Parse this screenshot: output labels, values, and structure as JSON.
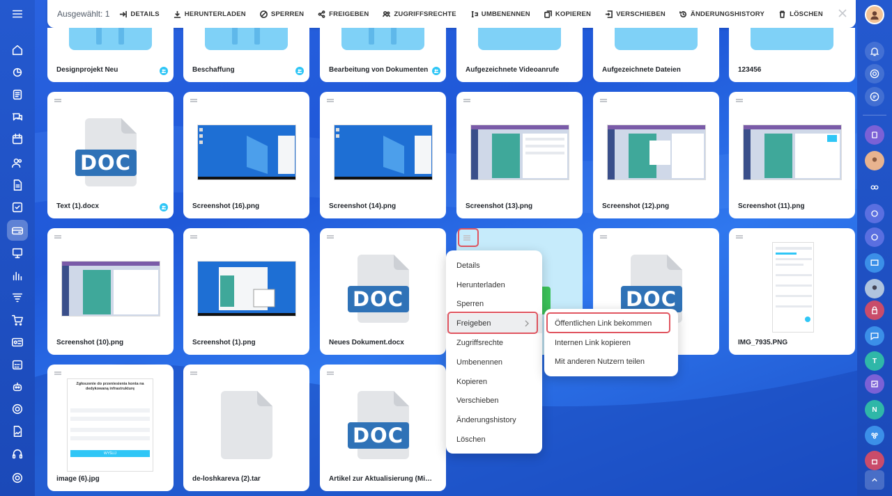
{
  "toolbar": {
    "selected": "Ausgewählt: 1",
    "details": "DETAILS",
    "download": "HERUNTERLADEN",
    "lock": "SPERREN",
    "share": "FREIGEBEN",
    "access": "ZUGRIFFSRECHTE",
    "rename": "UMBENENNEN",
    "copy": "KOPIEREN",
    "move": "VERSCHIEBEN",
    "history": "ÄNDERUNGSHISTORY",
    "delete": "LÖSCHEN"
  },
  "folders": [
    {
      "name": "Designprojekt Neu",
      "shared": true
    },
    {
      "name": "Beschaffung",
      "shared": true
    },
    {
      "name": "Bearbeitung von Dokumenten",
      "shared": true
    },
    {
      "name": "Aufgezeichnete Videoanrufe",
      "shared": false
    },
    {
      "name": "Aufgezeichnete Dateien",
      "shared": false
    },
    {
      "name": "123456",
      "shared": false
    }
  ],
  "row2": [
    {
      "name": "Text (1).docx",
      "kind": "doc",
      "shared": true
    },
    {
      "name": "Screenshot (16).png",
      "kind": "desktop"
    },
    {
      "name": "Screenshot (14).png",
      "kind": "desktop"
    },
    {
      "name": "Screenshot (13).png",
      "kind": "app"
    },
    {
      "name": "Screenshot (12).png",
      "kind": "app"
    },
    {
      "name": "Screenshot (11).png",
      "kind": "app"
    }
  ],
  "row3": [
    {
      "name": "Screenshot (10).png",
      "kind": "app"
    },
    {
      "name": "Screenshot (1).png",
      "kind": "desktop"
    },
    {
      "name": "Neues Dokument.docx",
      "kind": "doc"
    },
    {
      "name": "",
      "kind": "selected"
    },
    {
      "name": "",
      "kind": "doc"
    },
    {
      "name": "IMG_7935.PNG",
      "kind": "phone"
    }
  ],
  "row4": [
    {
      "name": "image (6).jpg",
      "kind": "form"
    },
    {
      "name": "de-loshkareva (2).tar",
      "kind": "blank"
    },
    {
      "name": "Artikel zur Aktualisierung (Mia Fu...",
      "kind": "doc"
    }
  ],
  "doc_label": "DOC",
  "form_preview": {
    "title": "Zgłoszenie do przeniesienia konta na dedykowaną infrastrukturę",
    "button": "WYŚLIJ"
  },
  "context_menu": [
    "Details",
    "Herunterladen",
    "Sperren",
    "Freigeben",
    "Zugriffsrechte",
    "Umbenennen",
    "Kopieren",
    "Verschieben",
    "Änderungshistory",
    "Löschen"
  ],
  "submenu": [
    "Öffentlichen Link bekommen",
    "Internen Link kopieren",
    "Mit anderen Nutzern teilen"
  ],
  "right_letters": [
    "T",
    "N"
  ],
  "colors": {
    "accent": "#2fc6f6",
    "highlight": "#e0545f",
    "doc_blue": "#2f72b7",
    "folder": "#7fd1f7"
  }
}
